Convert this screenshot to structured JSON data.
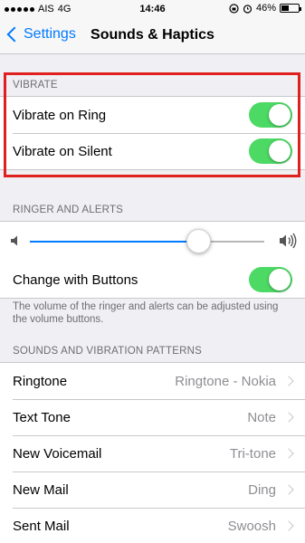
{
  "status_bar": {
    "carrier": "AIS",
    "network": "4G",
    "time": "14:46",
    "battery": "46%",
    "battery_level": 0.46
  },
  "nav": {
    "back_label": "Settings",
    "title": "Sounds & Haptics"
  },
  "vibrate": {
    "header": "VIBRATE",
    "items": [
      {
        "label": "Vibrate on Ring",
        "on": true
      },
      {
        "label": "Vibrate on Silent",
        "on": true
      }
    ]
  },
  "ringer": {
    "header": "RINGER AND ALERTS",
    "volume_level": 0.72,
    "change_with_buttons_label": "Change with Buttons",
    "change_with_buttons_on": true,
    "footer": "The volume of the ringer and alerts can be adjusted using the volume buttons."
  },
  "patterns": {
    "header": "SOUNDS AND VIBRATION PATTERNS",
    "items": [
      {
        "label": "Ringtone",
        "value": "Ringtone - Nokia"
      },
      {
        "label": "Text Tone",
        "value": "Note"
      },
      {
        "label": "New Voicemail",
        "value": "Tri-tone"
      },
      {
        "label": "New Mail",
        "value": "Ding"
      },
      {
        "label": "Sent Mail",
        "value": "Swoosh"
      }
    ]
  },
  "colors": {
    "accent": "#007aff",
    "toggle_on": "#4cd964",
    "highlight": "#e0201f"
  }
}
